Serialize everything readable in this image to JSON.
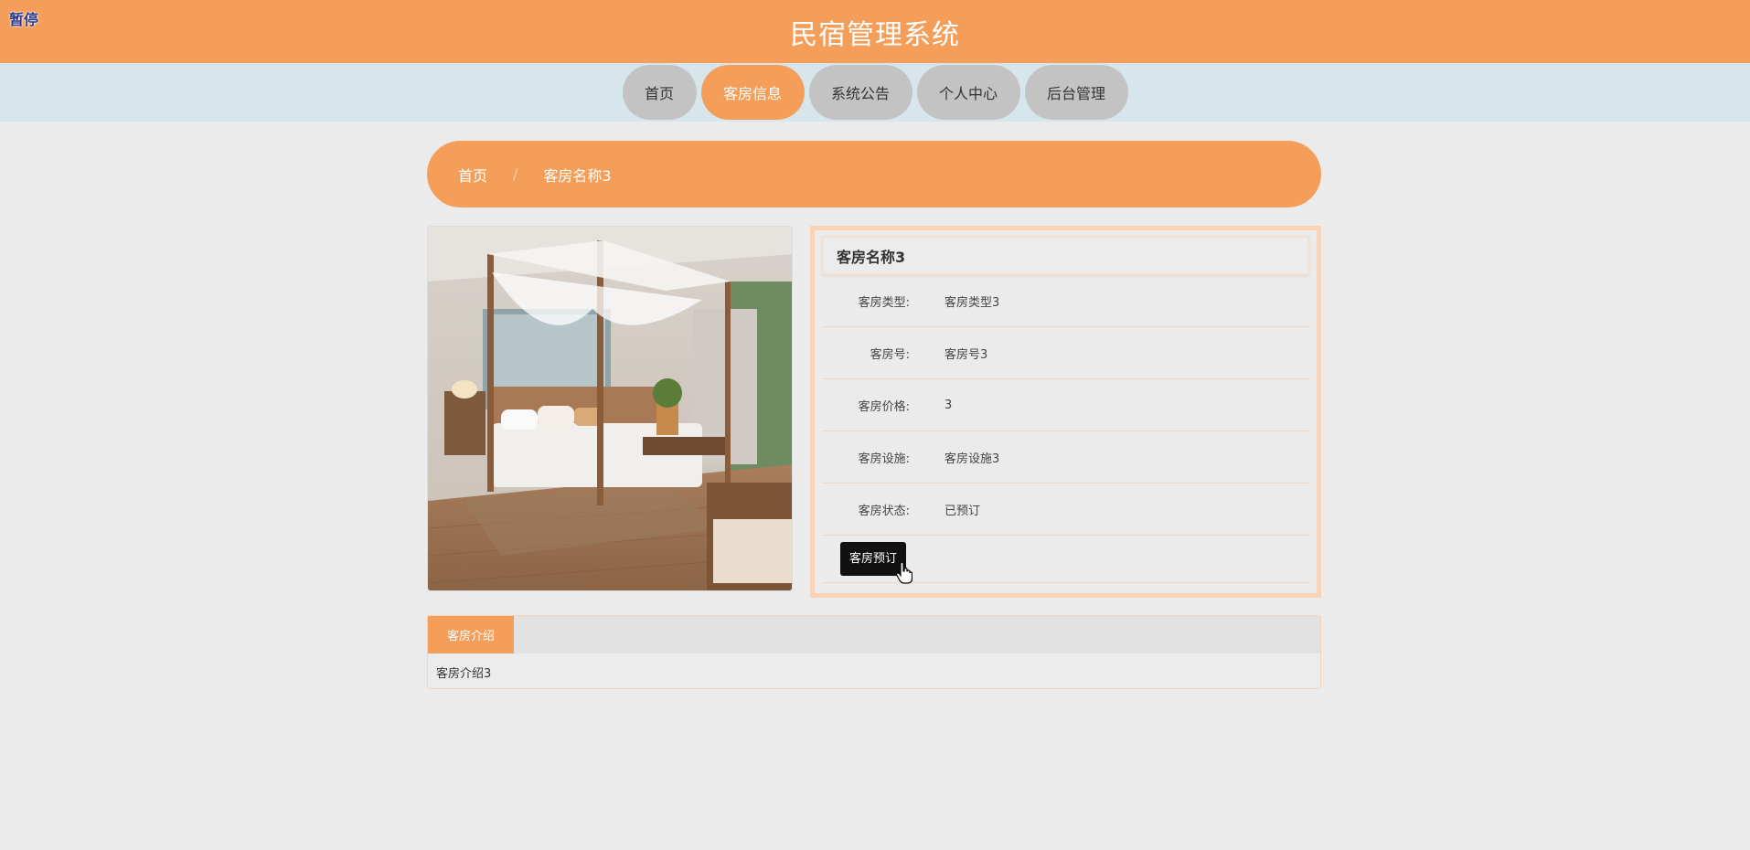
{
  "overlay": {
    "pause_label": "暂停"
  },
  "header": {
    "title": "民宿管理系统"
  },
  "nav": {
    "items": [
      {
        "label": "首页",
        "active": false
      },
      {
        "label": "客房信息",
        "active": true
      },
      {
        "label": "系统公告",
        "active": false
      },
      {
        "label": "个人中心",
        "active": false
      },
      {
        "label": "后台管理",
        "active": false
      }
    ]
  },
  "breadcrumb": {
    "home": "首页",
    "separator": "/",
    "current": "客房名称3"
  },
  "room": {
    "name": "客房名称3",
    "fields": [
      {
        "label": "客房类型:",
        "value": "客房类型3"
      },
      {
        "label": "客房号:",
        "value": "客房号3"
      },
      {
        "label": "客房价格:",
        "value": "3"
      },
      {
        "label": "客房设施:",
        "value": "客房设施3"
      },
      {
        "label": "客房状态:",
        "value": "已预订"
      }
    ],
    "book_button": "客房预订"
  },
  "intro": {
    "tab_label": "客房介绍",
    "content": "客房介绍3"
  },
  "colors": {
    "accent": "#f59e5a",
    "nav_bg": "#d6e6ec",
    "nav_item": "#c3c3c3"
  }
}
